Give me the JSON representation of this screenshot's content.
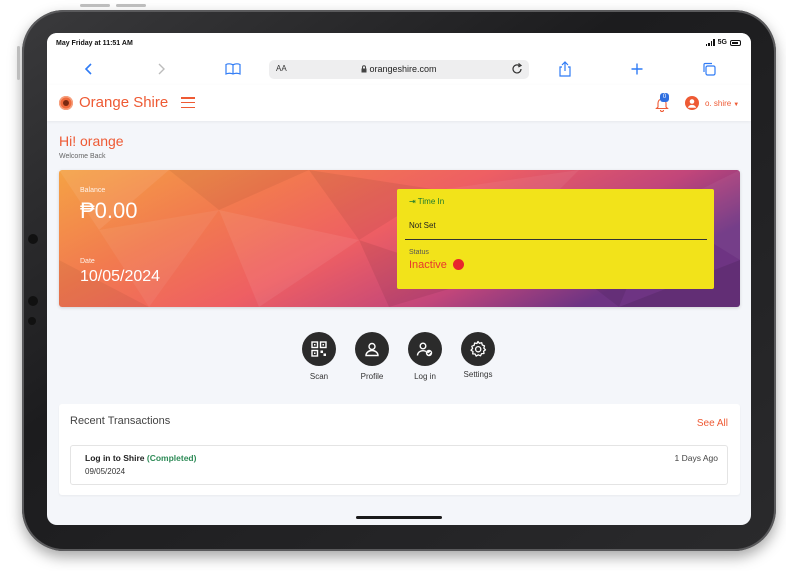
{
  "status_bar": {
    "time": "May Friday at 11:51 AM",
    "network": "5G"
  },
  "browser": {
    "text_size": "AA",
    "url": "orangeshire.com"
  },
  "header": {
    "brand": "Orange Shire",
    "notification_count": "0",
    "user": "o. shire"
  },
  "greeting": {
    "title": "Hi! orange",
    "subtitle": "Welcome Back"
  },
  "hero": {
    "balance_label": "Balance",
    "balance": "₱0.00",
    "date_label": "Date",
    "date": "10/05/2024",
    "time_in_label": "Time In",
    "time_in_value": "Not Set",
    "status_label": "Status",
    "status_value": "Inactive"
  },
  "actions": [
    {
      "label": "Scan",
      "icon": "qr-code-icon"
    },
    {
      "label": "Profile",
      "icon": "user-icon"
    },
    {
      "label": "Log in",
      "icon": "user-check-icon"
    },
    {
      "label": "Settings",
      "icon": "gear-icon"
    }
  ],
  "transactions": {
    "title": "Recent Transactions",
    "see_all": "See All",
    "items": [
      {
        "name": "Log in to Shire",
        "status": "(Completed)",
        "date": "09/05/2024",
        "ago": "1 Days Ago"
      }
    ]
  },
  "colors": {
    "accent": "#ee5a34",
    "time_card": "#f2e31a",
    "inactive": "#e8362d",
    "completed": "#2e8b57"
  }
}
